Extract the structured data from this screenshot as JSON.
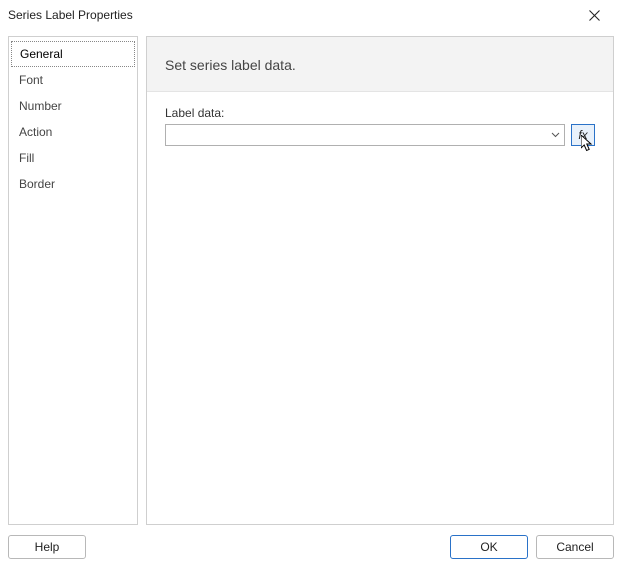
{
  "window": {
    "title": "Series Label Properties"
  },
  "sidebar": {
    "items": [
      {
        "label": "General",
        "selected": true
      },
      {
        "label": "Font",
        "selected": false
      },
      {
        "label": "Number",
        "selected": false
      },
      {
        "label": "Action",
        "selected": false
      },
      {
        "label": "Fill",
        "selected": false
      },
      {
        "label": "Border",
        "selected": false
      }
    ]
  },
  "panel": {
    "title": "Set series label data.",
    "labelData": {
      "label": "Label data:",
      "value": ""
    },
    "fxButton": {
      "label": "fx"
    }
  },
  "footer": {
    "help": "Help",
    "ok": "OK",
    "cancel": "Cancel"
  }
}
